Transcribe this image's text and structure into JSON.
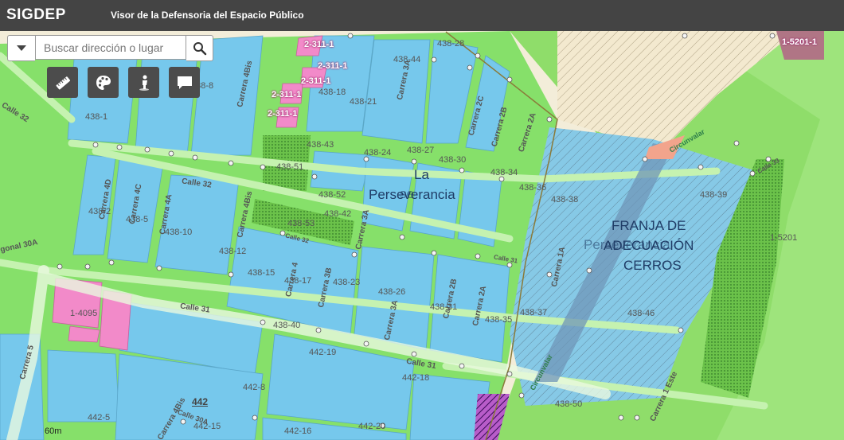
{
  "header": {
    "logo": "SIGDEP",
    "title": "Visor de la Defensoria del Espacio Público"
  },
  "search": {
    "placeholder": "Buscar dirección o lugar"
  },
  "tools": [
    {
      "name": "ruler-icon"
    },
    {
      "name": "palette-icon"
    },
    {
      "name": "street-view-icon"
    },
    {
      "name": "comment-icon"
    }
  ],
  "map_labels": {
    "neighborhood_1": "La",
    "neighborhood_2": "Perseverancia",
    "neighborhood_overlap": "se",
    "zone_1": "FRANJA DE",
    "zone_2": "ADECUACIÓN",
    "zone_3": "CERROS",
    "zone_overlap": "Perseverancia",
    "parcels": [
      "2-311-1",
      "2-311-1",
      "2-311-1",
      "2-311-1",
      "2-311-1",
      "1-5201-1",
      "1-5201",
      "1-4095",
      "438-28",
      "438-44",
      "438-18",
      "438-21",
      "438-1",
      "438-8",
      "438-43",
      "438-24",
      "438-27",
      "438-30",
      "438-34",
      "438-36",
      "438-38",
      "438-39",
      "438-51",
      "438-52",
      "438-42",
      "438-53",
      "438-2",
      "438-5",
      "438-10",
      "438-12",
      "438-15",
      "438-17",
      "438-23",
      "438-26",
      "438-31",
      "438-35",
      "438-37",
      "438-46",
      "438-40",
      "438-50",
      "442-19",
      "442-18",
      "442-8",
      "442-5",
      "442-15",
      "442-20",
      "442-16",
      "442"
    ],
    "streets": {
      "calle_32_a": "Calle 32",
      "calle_32_b": "Calle 32",
      "calle_32_c": "Calle 32",
      "calle_31_a": "Calle 31",
      "calle_31_b": "Calle 31",
      "calle_31_c": "Calle 31",
      "diagonal_30a": "gonal 30A",
      "carrera_5": "Carrera 5",
      "carrera_4bis_a": "Carrera 4Bis",
      "carrera_4bis_b": "Carrera 4Bis",
      "carrera_4bis_c": "Carrera 4Bis",
      "carrera_4d": "Carrera 4D",
      "carrera_4c": "Carrera 4C",
      "carrera_4a": "Carrera 4A",
      "carrera_4": "Carrera 4",
      "carrera_3b": "Carrera 3B",
      "carrera_3a_a": "Carrera 3A",
      "carrera_3a_b": "Carrera 3A",
      "carrera_3a_c": "Carrera 3A",
      "carrera_2b_a": "Carrera 2B",
      "carrera_2b_b": "Carrera 2B",
      "carrera_2a_a": "Carrera 2A",
      "carrera_2a_b": "Carrera 2A",
      "carrera_2c": "Carrera 2C",
      "carrera_1a": "Carrera 1A",
      "carrera_1_este": "Carrera 1 Este",
      "circunvalar_a": "Circunvalar",
      "circunvalar_b": "Circunvalar",
      "calle_30a": "Calle 30A",
      "calle_33": "Calle 33"
    },
    "scale": "60m"
  }
}
